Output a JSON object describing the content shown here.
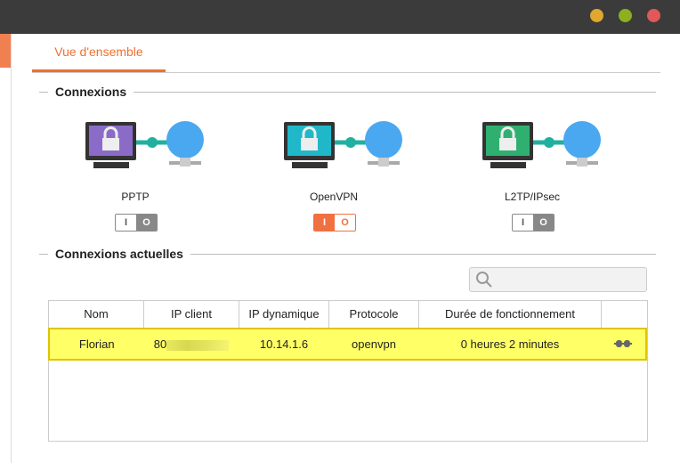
{
  "window": {
    "controls": [
      {
        "name": "minimize",
        "color": "#e0a830"
      },
      {
        "name": "maximize",
        "color": "#8cb020"
      },
      {
        "name": "close",
        "color": "#e05858"
      }
    ]
  },
  "tabs": [
    {
      "label": "Vue d'ensemble",
      "active": true
    }
  ],
  "connections": {
    "title": "Connexions",
    "items": [
      {
        "label": "PPTP",
        "enabled": false,
        "screen_color": "#8a6cc8",
        "on": "I",
        "off": "O"
      },
      {
        "label": "OpenVPN",
        "enabled": true,
        "screen_color": "#20b8c8",
        "on": "I",
        "off": "O"
      },
      {
        "label": "L2TP/IPsec",
        "enabled": false,
        "screen_color": "#30b070",
        "on": "I",
        "off": "O"
      }
    ]
  },
  "current": {
    "title": "Connexions actuelles",
    "search_placeholder": "",
    "columns": [
      "Nom",
      "IP client",
      "IP dynamique",
      "Protocole",
      "Durée de fonctionnement",
      ""
    ],
    "rows": [
      {
        "name": "Florian",
        "ip_client": "80",
        "ip_dyn": "10.14.1.6",
        "protocol": "openvpn",
        "uptime": "0 heures 2 minutes",
        "action_icon": "disconnect-icon"
      }
    ]
  }
}
